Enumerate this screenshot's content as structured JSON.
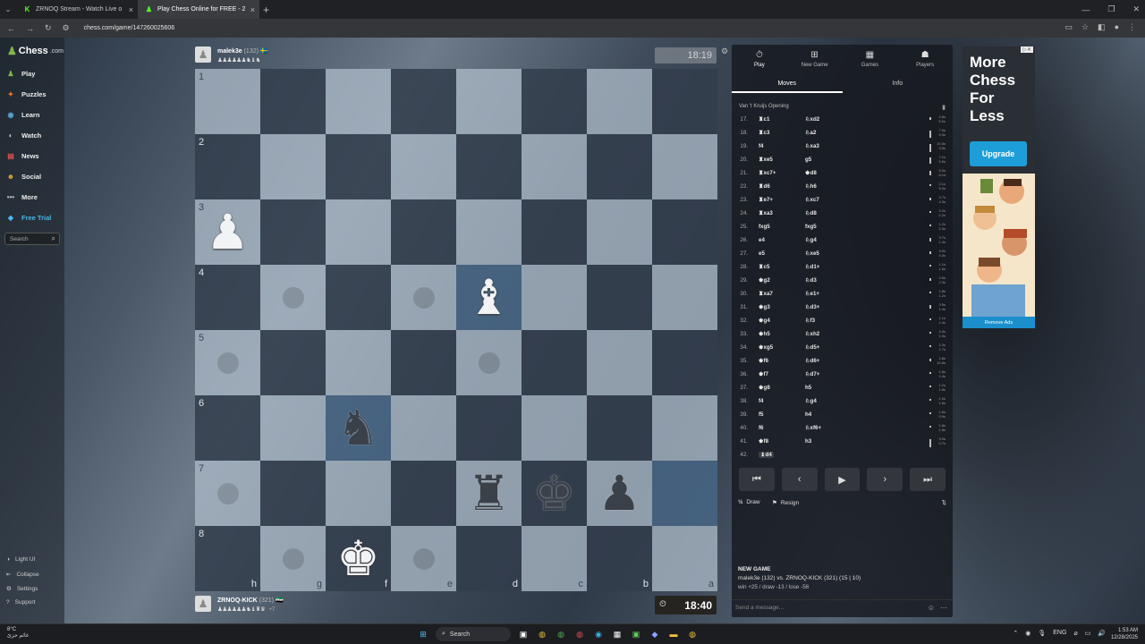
{
  "browser": {
    "tabs": [
      {
        "label": "ZRNOQ Stream - Watch Live o",
        "icon": "kick-icon"
      },
      {
        "label": "Play Chess Online for FREE - 2",
        "icon": "chess-icon",
        "active": true
      }
    ],
    "url": "chess.com/game/147260025606"
  },
  "sidebar": {
    "logo_text": "Chess",
    "logo_suffix": ".com",
    "items": [
      {
        "label": "Play",
        "icon": "play-icon",
        "color": "#81b64c"
      },
      {
        "label": "Puzzles",
        "icon": "puzzle-icon",
        "color": "#e97a2b"
      },
      {
        "label": "Learn",
        "icon": "learn-icon",
        "color": "#5aa0d0"
      },
      {
        "label": "Watch",
        "icon": "watch-icon",
        "color": "#c0c0c0"
      },
      {
        "label": "News",
        "icon": "news-icon",
        "color": "#e05050"
      },
      {
        "label": "Social",
        "icon": "social-icon",
        "color": "#e0a030"
      },
      {
        "label": "More",
        "icon": "more-icon",
        "color": "#c0c0c0"
      },
      {
        "label": "Free Trial",
        "icon": "diamond-icon",
        "color": "#4cb7e8"
      }
    ],
    "search_placeholder": "Search",
    "footer": [
      {
        "label": "Light UI",
        "icon": "theme-icon"
      },
      {
        "label": "Collapse",
        "icon": "collapse-icon"
      },
      {
        "label": "Settings",
        "icon": "gear-icon"
      },
      {
        "label": "Support",
        "icon": "help-icon"
      }
    ]
  },
  "top_player": {
    "name": "malek3e",
    "rating": "(132)",
    "flag": "🇸🇪",
    "captured": "♟♟♟♟♟♟♞♝♞",
    "clock": "18:19"
  },
  "bottom_player": {
    "name": "ZRNOQ-KICK",
    "rating": "(321)",
    "flag": "🇸🇾",
    "captured": "♟♟♟♟♟♟♞♝♜♛",
    "material": "+7",
    "clock": "18:40"
  },
  "board": {
    "ranks": [
      "1",
      "2",
      "3",
      "4",
      "5",
      "6",
      "7",
      "8"
    ],
    "files": [
      "h",
      "g",
      "f",
      "e",
      "d",
      "c",
      "b",
      "a"
    ],
    "pieces": [
      {
        "square": "3-0",
        "glyph": "♟",
        "color": "white",
        "name": "white-pawn"
      },
      {
        "square": "4-4",
        "glyph": "♝",
        "color": "white",
        "name": "white-bishop"
      },
      {
        "square": "6-2",
        "glyph": "♞",
        "color": "black",
        "name": "black-knight"
      },
      {
        "square": "7-4",
        "glyph": "♜",
        "color": "black",
        "name": "black-rook"
      },
      {
        "square": "7-5",
        "glyph": "♚",
        "color": "black",
        "name": "black-king"
      },
      {
        "square": "7-6",
        "glyph": "♟",
        "color": "black",
        "name": "black-pawn"
      },
      {
        "square": "8-2",
        "glyph": "♚",
        "color": "white",
        "name": "white-king"
      }
    ],
    "hints": [
      "4-1",
      "4-3",
      "5-0",
      "5-4",
      "7-0",
      "8-1",
      "8-3"
    ],
    "highlights": [
      "4-4",
      "6-2",
      "7-7"
    ]
  },
  "panel": {
    "nav": [
      {
        "label": "Play",
        "icon": "play-icon",
        "active": true
      },
      {
        "label": "New Game",
        "icon": "plus-icon"
      },
      {
        "label": "Games",
        "icon": "games-icon"
      },
      {
        "label": "Players",
        "icon": "players-icon"
      }
    ],
    "tabs": [
      {
        "label": "Moves",
        "active": true
      },
      {
        "label": "Info"
      }
    ],
    "opening": "Van 't Kruijs Opening",
    "moves": [
      {
        "n": "17.",
        "w": "♜c1",
        "b": "♘xd2",
        "wt": "2.8s",
        "bt": "6.0s"
      },
      {
        "n": "18.",
        "w": "♜c3",
        "b": "♘a2",
        "wt": "7.6s",
        "bt": "5.3s"
      },
      {
        "n": "19.",
        "w": "f4",
        "b": "♘xa3",
        "wt": "10.5s",
        "bt": "4.0s"
      },
      {
        "n": "20.",
        "w": "♜xe5",
        "b": "g5",
        "wt": "7.1s",
        "bt": "5.9s"
      },
      {
        "n": "21.",
        "w": "♜xc7+",
        "b": "♚d8",
        "wt": "5.0s",
        "bt": "6.1s"
      },
      {
        "n": "22.",
        "w": "♜d6",
        "b": "♘h6",
        "wt": "2.1s",
        "bt": "5.0s"
      },
      {
        "n": "23.",
        "w": "♜e7+",
        "b": "♘xc7",
        "wt": "2.7s",
        "bt": "4.3s"
      },
      {
        "n": "24.",
        "w": "♜xa3",
        "b": "♘d8",
        "wt": "2.2s",
        "bt": "1.2s"
      },
      {
        "n": "25.",
        "w": "fxg5",
        "b": "fxg5",
        "wt": "1.2s",
        "bt": "2.3s"
      },
      {
        "n": "26.",
        "w": "e4",
        "b": "♘g4",
        "wt": "3.7s",
        "bt": "1.4s"
      },
      {
        "n": "27.",
        "w": "e5",
        "b": "♘xe5",
        "wt": "3.0s",
        "bt": "4.3s"
      },
      {
        "n": "28.",
        "w": "♜c5",
        "b": "♘d1+",
        "wt": "1.1s",
        "bt": "1.6s"
      },
      {
        "n": "29.",
        "w": "♚g2",
        "b": "♘d3",
        "wt": "2.5s",
        "bt": "2.3s"
      },
      {
        "n": "30.",
        "w": "♜xa7",
        "b": "♘e1+",
        "wt": "1.8s",
        "bt": "1.2s"
      },
      {
        "n": "31.",
        "w": "♚g3",
        "b": "♘d3+",
        "wt": "3.9s",
        "bt": "1.4s"
      },
      {
        "n": "32.",
        "w": "♚g4",
        "b": "♘f3",
        "wt": "1.1s",
        "bt": "1.4s"
      },
      {
        "n": "33.",
        "w": "♚h5",
        "b": "♘xh2",
        "wt": "2.4s",
        "bt": "1.0s"
      },
      {
        "n": "34.",
        "w": "♚xg5",
        "b": "♘d5+",
        "wt": "2.3s",
        "bt": "1.7s"
      },
      {
        "n": "35.",
        "w": "♚f6",
        "b": "♘d6+",
        "wt": "2.8s",
        "bt": "10.8s"
      },
      {
        "n": "36.",
        "w": "♚f7",
        "b": "♘d7+",
        "wt": "1.8s",
        "bt": "1.4s"
      },
      {
        "n": "37.",
        "w": "♚g8",
        "b": "h5",
        "wt": "1.2s",
        "bt": "1.8s"
      },
      {
        "n": "38.",
        "w": "f4",
        "b": "♘g4",
        "wt": "1.0s",
        "bt": "1.6s"
      },
      {
        "n": "39.",
        "w": "f5",
        "b": "h4",
        "wt": "1.6s",
        "bt": "0.9s"
      },
      {
        "n": "40.",
        "w": "f6",
        "b": "♘xf6+",
        "wt": "1.8s",
        "bt": "1.8s"
      },
      {
        "n": "41.",
        "w": "♚f8",
        "b": "h3",
        "wt": "9.0s",
        "bt": "0.7s"
      },
      {
        "n": "42.",
        "w": "♝d4",
        "b": "",
        "wt": "",
        "bt": "",
        "current": true
      }
    ],
    "controls": [
      "first-move-icon",
      "prev-move-icon",
      "play-icon",
      "next-move-icon",
      "last-move-icon"
    ],
    "draw_label": "Draw",
    "resign_label": "Resign",
    "new_game_title": "NEW GAME",
    "new_game_line1": "malek3e (132) vs. ZRNOQ-KICK (321) (15 | 10)",
    "new_game_line2": "win +25 / draw -13 / lose -56",
    "chat_placeholder": "Send a message..."
  },
  "ad": {
    "title": "More Chess For Less",
    "button": "Upgrade",
    "remove": "Remove Ads"
  },
  "taskbar": {
    "weather_temp": "8°C",
    "weather_desc": "غائم جزئ",
    "search": "Search",
    "lang": "ENG",
    "time": "1:53 AM",
    "date": "12/28/2025"
  }
}
